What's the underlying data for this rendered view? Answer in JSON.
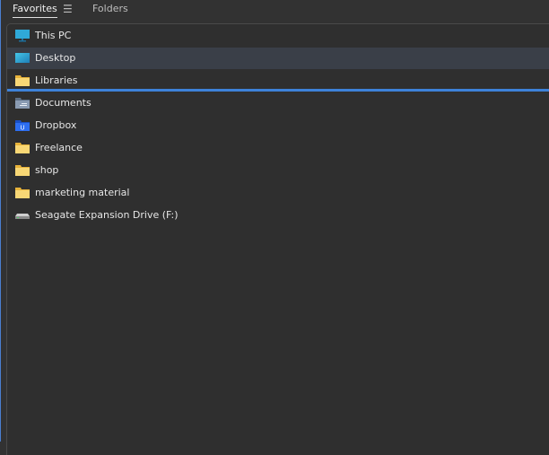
{
  "tabs": {
    "favorites": "Favorites",
    "folders": "Folders",
    "menu_icon": "hamburger-menu-icon"
  },
  "items": [
    {
      "label": "This PC",
      "icon": "monitor-icon"
    },
    {
      "label": "Desktop",
      "icon": "desktop-icon",
      "selected": true
    },
    {
      "label": "Libraries",
      "icon": "folder-icon"
    },
    {
      "label": "Documents",
      "icon": "documents-icon"
    },
    {
      "label": "Dropbox",
      "icon": "dropbox-folder-icon"
    },
    {
      "label": "Freelance",
      "icon": "folder-icon"
    },
    {
      "label": "shop",
      "icon": "folder-icon"
    },
    {
      "label": "marketing material",
      "icon": "folder-icon"
    },
    {
      "label": "Seagate Expansion Drive (F:)",
      "icon": "drive-icon"
    }
  ],
  "colors": {
    "accent": "#3d82d9",
    "folder": "#f5cf63",
    "selected_row": "#3a3f48"
  }
}
